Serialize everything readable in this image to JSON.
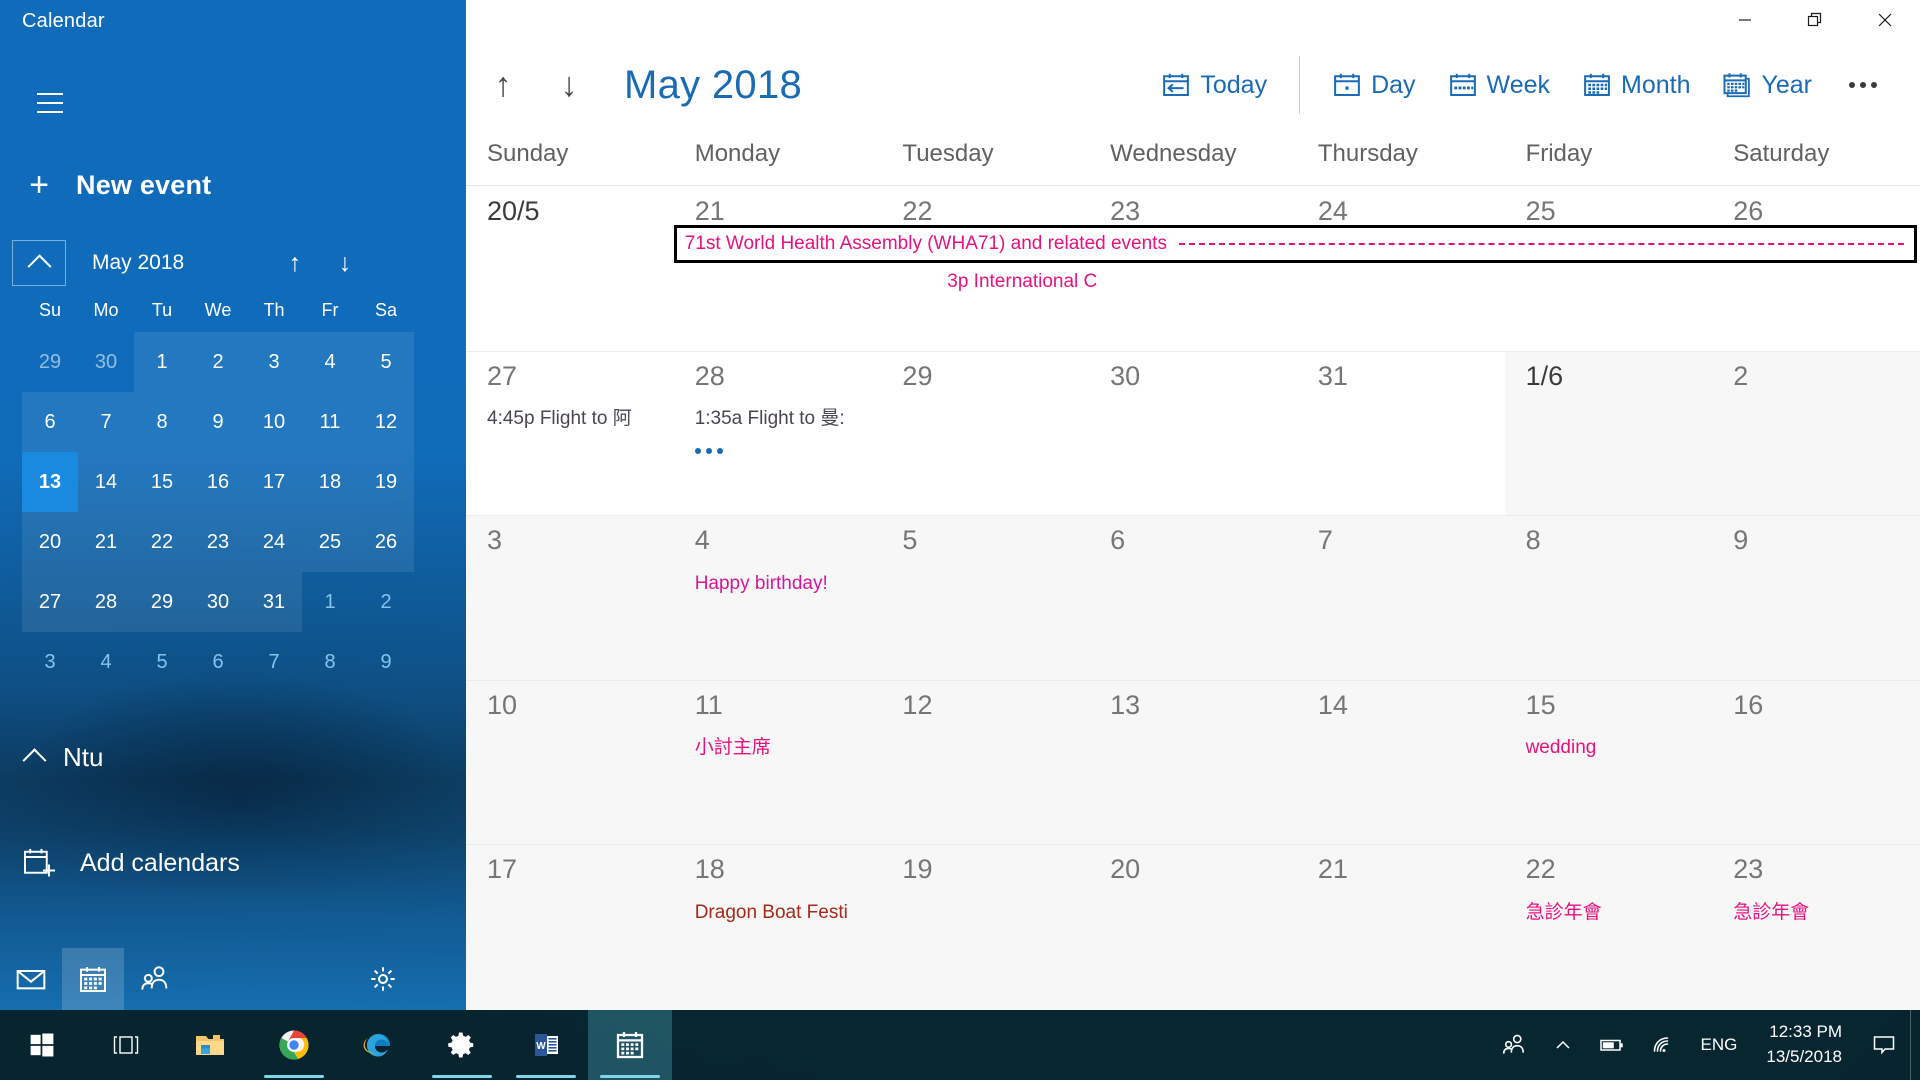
{
  "window": {
    "app_title": "Calendar",
    "minimize_label": "Minimize",
    "restore_label": "Restore",
    "close_label": "Close"
  },
  "sidebar": {
    "hamburger_name": "hamburger-menu-icon",
    "new_event_label": "New event",
    "new_event_plus": "+",
    "mini_calendar": {
      "title": "May 2018",
      "prev_label": "↑",
      "next_label": "↓",
      "dow": [
        "Su",
        "Mo",
        "Tu",
        "We",
        "Th",
        "Fr",
        "Sa"
      ],
      "weeks": [
        [
          {
            "d": "29",
            "style": "muted"
          },
          {
            "d": "30",
            "style": "muted"
          },
          {
            "d": "1",
            "style": ""
          },
          {
            "d": "2",
            "style": ""
          },
          {
            "d": "3",
            "style": ""
          },
          {
            "d": "4",
            "style": ""
          },
          {
            "d": "5",
            "style": ""
          }
        ],
        [
          {
            "d": "6",
            "style": ""
          },
          {
            "d": "7",
            "style": ""
          },
          {
            "d": "8",
            "style": ""
          },
          {
            "d": "9",
            "style": ""
          },
          {
            "d": "10",
            "style": ""
          },
          {
            "d": "11",
            "style": ""
          },
          {
            "d": "12",
            "style": ""
          }
        ],
        [
          {
            "d": "13",
            "style": "today"
          },
          {
            "d": "14",
            "style": ""
          },
          {
            "d": "15",
            "style": ""
          },
          {
            "d": "16",
            "style": ""
          },
          {
            "d": "17",
            "style": ""
          },
          {
            "d": "18",
            "style": ""
          },
          {
            "d": "19",
            "style": ""
          }
        ],
        [
          {
            "d": "20",
            "style": ""
          },
          {
            "d": "21",
            "style": ""
          },
          {
            "d": "22",
            "style": ""
          },
          {
            "d": "23",
            "style": ""
          },
          {
            "d": "24",
            "style": ""
          },
          {
            "d": "25",
            "style": ""
          },
          {
            "d": "26",
            "style": ""
          }
        ],
        [
          {
            "d": "27",
            "style": ""
          },
          {
            "d": "28",
            "style": ""
          },
          {
            "d": "29",
            "style": ""
          },
          {
            "d": "30",
            "style": ""
          },
          {
            "d": "31",
            "style": ""
          },
          {
            "d": "1",
            "style": "next"
          },
          {
            "d": "2",
            "style": "next"
          }
        ],
        [
          {
            "d": "3",
            "style": "next"
          },
          {
            "d": "4",
            "style": "next"
          },
          {
            "d": "5",
            "style": "next"
          },
          {
            "d": "6",
            "style": "next"
          },
          {
            "d": "7",
            "style": "next"
          },
          {
            "d": "8",
            "style": "next"
          },
          {
            "d": "9",
            "style": "next"
          }
        ]
      ]
    },
    "account_label": "Ntu",
    "add_calendars_label": "Add calendars",
    "bottom_nav": [
      {
        "name": "mail-icon",
        "label": "Mail",
        "active": false
      },
      {
        "name": "calendar-icon",
        "label": "Calendar",
        "active": true
      },
      {
        "name": "people-icon",
        "label": "People",
        "active": false
      },
      {
        "name": "gear-icon",
        "label": "Settings",
        "active": false
      }
    ]
  },
  "toolbar": {
    "prev_label": "↑",
    "next_label": "↓",
    "month_title": "May 2018",
    "today_label": "Today",
    "day_label": "Day",
    "week_label": "Week",
    "month_label": "Month",
    "year_label": "Year",
    "more_label": "More"
  },
  "calendar": {
    "day_headers": [
      "Sunday",
      "Monday",
      "Tuesday",
      "Wednesday",
      "Thursday",
      "Friday",
      "Saturday"
    ],
    "span_event": {
      "title": "71st World Health Assembly (WHA71) and related events",
      "selected": true,
      "color": "#e8117f"
    },
    "span_sub_event": {
      "title": "3p International C",
      "color": "#e8117f"
    },
    "weeks": [
      {
        "days": [
          {
            "num": "20/5",
            "current": true,
            "shaded": false,
            "events": []
          },
          {
            "num": "21",
            "current": false,
            "shaded": false,
            "events": []
          },
          {
            "num": "22",
            "current": false,
            "shaded": false,
            "events": []
          },
          {
            "num": "23",
            "current": false,
            "shaded": false,
            "events": []
          },
          {
            "num": "24",
            "current": false,
            "shaded": false,
            "events": []
          },
          {
            "num": "25",
            "current": false,
            "shaded": false,
            "events": []
          },
          {
            "num": "26",
            "current": false,
            "shaded": false,
            "events": []
          }
        ]
      },
      {
        "days": [
          {
            "num": "27",
            "current": false,
            "shaded": false,
            "events": [
              {
                "text": "4:45p Flight to 阿",
                "color": "gray"
              }
            ]
          },
          {
            "num": "28",
            "current": false,
            "shaded": false,
            "events": [
              {
                "text": "1:35a Flight to 曼:",
                "color": "gray"
              }
            ],
            "more": true
          },
          {
            "num": "29",
            "current": false,
            "shaded": false,
            "events": []
          },
          {
            "num": "30",
            "current": false,
            "shaded": false,
            "events": []
          },
          {
            "num": "31",
            "current": false,
            "shaded": false,
            "events": []
          },
          {
            "num": "1/6",
            "current": true,
            "shaded": true,
            "events": []
          },
          {
            "num": "2",
            "current": false,
            "shaded": true,
            "events": []
          }
        ]
      },
      {
        "days": [
          {
            "num": "3",
            "current": false,
            "shaded": true,
            "events": []
          },
          {
            "num": "4",
            "current": false,
            "shaded": true,
            "events": [
              {
                "text": "Happy birthday!",
                "color": "magenta"
              }
            ]
          },
          {
            "num": "5",
            "current": false,
            "shaded": true,
            "events": []
          },
          {
            "num": "6",
            "current": false,
            "shaded": true,
            "events": []
          },
          {
            "num": "7",
            "current": false,
            "shaded": true,
            "events": []
          },
          {
            "num": "8",
            "current": false,
            "shaded": true,
            "events": []
          },
          {
            "num": "9",
            "current": false,
            "shaded": true,
            "events": []
          }
        ]
      },
      {
        "days": [
          {
            "num": "10",
            "current": false,
            "shaded": true,
            "events": []
          },
          {
            "num": "11",
            "current": false,
            "shaded": true,
            "events": [
              {
                "text": "小討主席",
                "color": "pink"
              }
            ]
          },
          {
            "num": "12",
            "current": false,
            "shaded": true,
            "events": []
          },
          {
            "num": "13",
            "current": false,
            "shaded": true,
            "events": []
          },
          {
            "num": "14",
            "current": false,
            "shaded": true,
            "events": []
          },
          {
            "num": "15",
            "current": false,
            "shaded": true,
            "events": [
              {
                "text": "wedding",
                "color": "pink"
              }
            ]
          },
          {
            "num": "16",
            "current": false,
            "shaded": true,
            "events": []
          }
        ]
      },
      {
        "days": [
          {
            "num": "17",
            "current": false,
            "shaded": true,
            "events": []
          },
          {
            "num": "18",
            "current": false,
            "shaded": true,
            "events": [
              {
                "text": "Dragon Boat Festi",
                "color": "darkred"
              }
            ]
          },
          {
            "num": "19",
            "current": false,
            "shaded": true,
            "events": []
          },
          {
            "num": "20",
            "current": false,
            "shaded": true,
            "events": []
          },
          {
            "num": "21",
            "current": false,
            "shaded": true,
            "events": []
          },
          {
            "num": "22",
            "current": false,
            "shaded": true,
            "events": [
              {
                "text": "急診年會",
                "color": "pink"
              }
            ]
          },
          {
            "num": "23",
            "current": false,
            "shaded": true,
            "events": [
              {
                "text": "急診年會",
                "color": "pink"
              }
            ]
          }
        ]
      }
    ]
  },
  "taskbar": {
    "items": [
      {
        "name": "start-button",
        "label": "Start",
        "active": false,
        "running": false
      },
      {
        "name": "task-view-button",
        "label": "Task View",
        "active": false,
        "running": false
      },
      {
        "name": "file-explorer-button",
        "label": "File Explorer",
        "active": false,
        "running": false
      },
      {
        "name": "chrome-button",
        "label": "Google Chrome",
        "active": false,
        "running": true
      },
      {
        "name": "edge-button",
        "label": "Internet Explorer",
        "active": false,
        "running": false
      },
      {
        "name": "settings-button",
        "label": "Settings",
        "active": false,
        "running": true
      },
      {
        "name": "word-button",
        "label": "Word",
        "active": false,
        "running": true
      },
      {
        "name": "calendar-taskbar-button",
        "label": "Calendar",
        "active": true,
        "running": true
      }
    ],
    "tray": {
      "people_label": "People",
      "chevron_label": "Show hidden icons",
      "battery_label": "Battery",
      "network_label": "Network",
      "language": "ENG",
      "time": "12:33 PM",
      "date": "13/5/2018",
      "action_center_label": "Action Center"
    }
  },
  "colors": {
    "accent": "#1a6bb5",
    "sidebar": "#106ebe",
    "event_pink": "#e8117f",
    "today_highlight": "#1a8ae0"
  }
}
